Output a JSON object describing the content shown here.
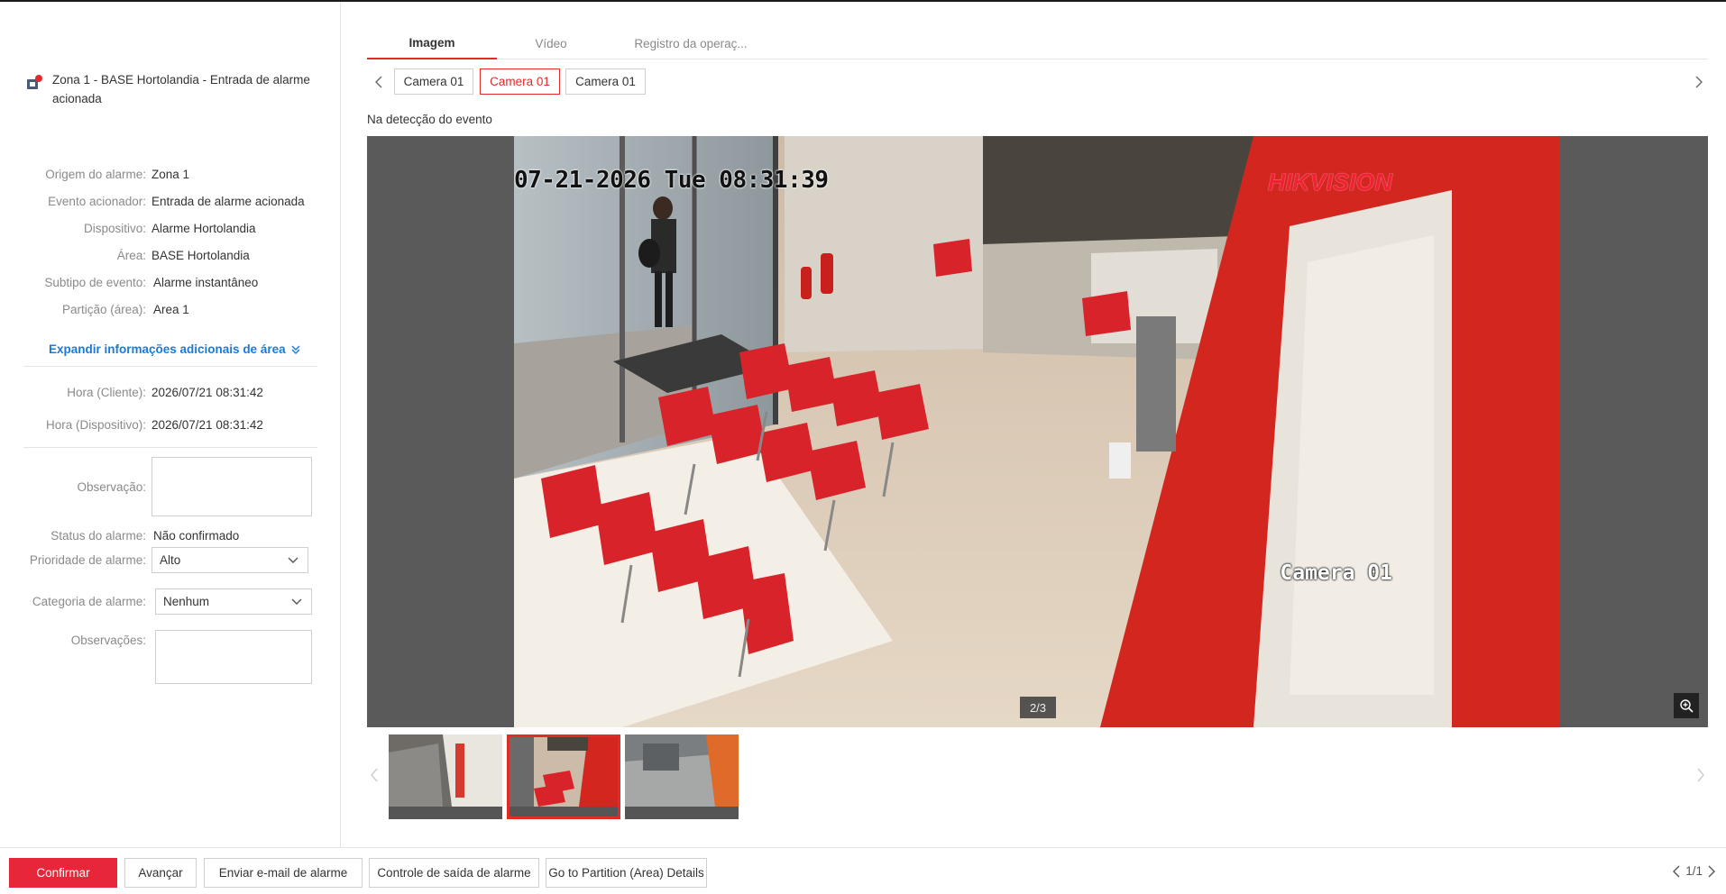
{
  "alarm": {
    "title": "Zona 1 - BASE Hortolandia - Entrada de alarme acionada"
  },
  "details": [
    {
      "label": "Origem do alarme:",
      "value": "Zona 1"
    },
    {
      "label": "Evento acionador:",
      "value": "Entrada de alarme acionada"
    },
    {
      "label": "Dispositivo:",
      "value": "Alarme Hortolandia"
    },
    {
      "label": "Área:",
      "value": "BASE Hortolandia"
    },
    {
      "label": "Subtipo de evento:",
      "value": "Alarme instantâneo"
    },
    {
      "label": "Partição (área):",
      "value": "Area 1"
    }
  ],
  "expand_link": "Expandir informações adicionais de área",
  "times": [
    {
      "label": "Hora (Cliente):",
      "value": "2026/07/21 08:31:42"
    },
    {
      "label": "Hora (Dispositivo):",
      "value": "2026/07/21 08:31:42"
    }
  ],
  "form": {
    "observacao_label": "Observação:",
    "observacao_value": "",
    "status_label": "Status do alarme:",
    "status_value": "Não confirmado",
    "prioridade_label": "Prioridade de alarme:",
    "prioridade_value": "Alto",
    "categoria_label": "Categoria de alarme:",
    "categoria_value": "Nenhum",
    "observacoes_label": "Observações:",
    "observacoes_value": ""
  },
  "tabs": [
    {
      "label": "Imagem",
      "active": true
    },
    {
      "label": "Vídeo",
      "active": false
    },
    {
      "label": "Registro da operaç...",
      "active": false
    }
  ],
  "cameras": [
    {
      "label": "Camera 01",
      "active": false
    },
    {
      "label": "Camera 01",
      "active": true
    },
    {
      "label": "Camera 01",
      "active": false
    }
  ],
  "event_caption": "Na detecção do evento",
  "viewer": {
    "osd_time": "07-21-2026 Tue 08:31:39",
    "osd_brand": "HIKVISION",
    "osd_camera": "Camera 01",
    "page_indicator": "2/3"
  },
  "thumbnails": [
    {
      "active": false
    },
    {
      "active": true
    },
    {
      "active": false
    }
  ],
  "footer": {
    "confirm": "Confirmar",
    "next": "Avançar",
    "email": "Enviar e-mail de alarme",
    "output_control": "Controle de saída de alarme",
    "partition_details": "Go to Partition (Area) Details",
    "pager": "1/1"
  },
  "colors": {
    "accent": "#e02b2b",
    "primary_button": "#e8263a",
    "link": "#1a7ad6"
  }
}
